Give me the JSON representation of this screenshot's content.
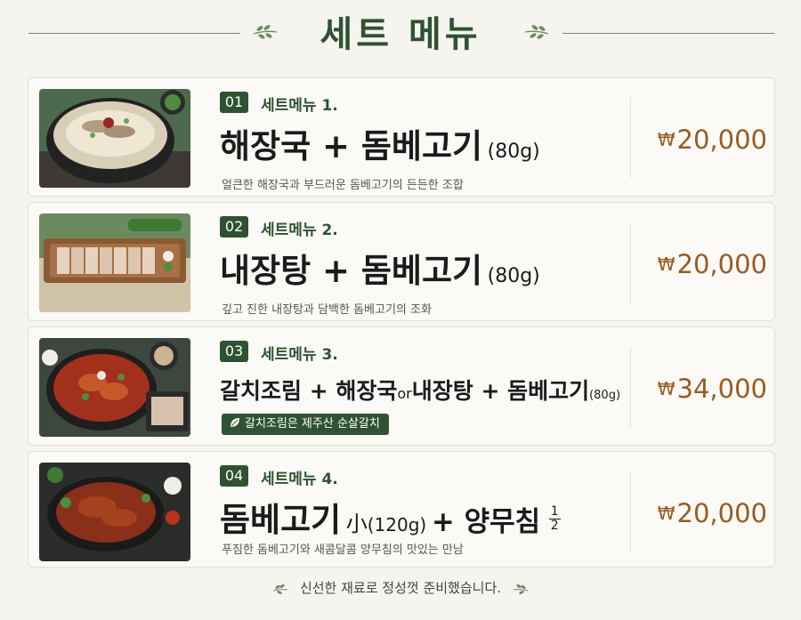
{
  "header": {
    "title": "세트 메뉴"
  },
  "items": [
    {
      "num": "01",
      "label": "세트메뉴 1.",
      "dish": "해장국 + 돔베고기",
      "weight": "(80g)",
      "desc": "얼큰한 해장국과 부드러운 돔베고기의 든든한 조합",
      "currency": "₩",
      "price": "20,000",
      "photo_icon": "hangover-soup-photo"
    },
    {
      "num": "02",
      "label": "세트메뉴 2.",
      "dish": "내장탕 + 돔베고기",
      "weight": "(80g)",
      "desc": "깊고 진한 내장탕과 담백한 돔베고기의 조화",
      "currency": "₩",
      "price": "20,000",
      "photo_icon": "sliced-pork-photo"
    },
    {
      "num": "03",
      "label": "세트메뉴 3.",
      "dish_a": "갈치조림 + 해장국",
      "dish_or": "or",
      "dish_b": "내장탕 + 돔베고기",
      "weight": "(80g)",
      "tag": "갈치조림은 제주산 순살갈치",
      "currency": "₩",
      "price": "34,000",
      "photo_icon": "braised-fish-photo"
    },
    {
      "num": "04",
      "label": "세트메뉴 4.",
      "dish_a": "돔베고기",
      "size": "小",
      "weight": "(120g)",
      "dish_b": "+ 양무침",
      "frac_top": "1",
      "frac_bottom": "2",
      "desc": "푸짐한 돔베고기와 새콤달콤 양무침의 맛있는 만남",
      "currency": "₩",
      "price": "20,000",
      "photo_icon": "spicy-pork-photo"
    }
  ],
  "footer": {
    "text": "신선한 재료로 정성껏 준비했습니다."
  },
  "colors": {
    "green": "#2f5233",
    "price": "#9a5a23",
    "background": "#f6f4ee"
  }
}
